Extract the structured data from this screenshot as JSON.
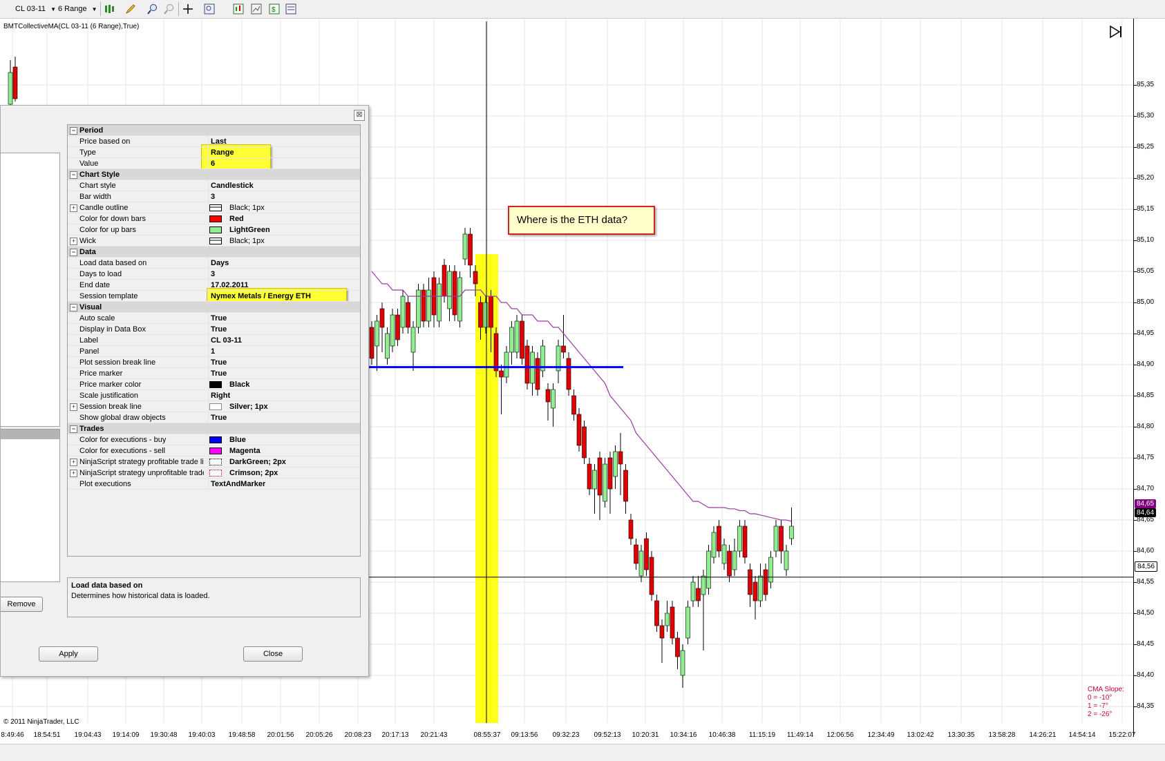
{
  "toolbar": {
    "instrument": "CL 03-11",
    "period": "6 Range"
  },
  "chart": {
    "indicator_label": "BMTCollectiveMA(CL 03-11 (6 Range),True)",
    "copyright": "© 2011 NinjaTrader, LLC",
    "callout": "Where is the ETH data?",
    "cma_slope": {
      "title": "CMA Slope:",
      "lines": [
        "0 = -10°",
        "1 = -7°",
        "2 = -26°"
      ]
    },
    "colors": {
      "up": "#90ee90",
      "down": "#e00000",
      "ma": "#9b3aa5",
      "buy_line": "#0000ff",
      "highlight": "#ffff00"
    },
    "price_badges": [
      {
        "value": "84,65",
        "color": "#800080"
      },
      {
        "value": "84,64",
        "color": "#000000"
      },
      {
        "value": "84,56",
        "color": "#ffffff"
      }
    ]
  },
  "chart_data": {
    "type": "candlestick",
    "y_axis_labels": [
      "85,35",
      "85,30",
      "85,25",
      "85,20",
      "85,15",
      "85,10",
      "85,05",
      "85,00",
      "84,95",
      "84,90",
      "84,85",
      "84,80",
      "84,75",
      "84,70",
      "84,65",
      "84,60",
      "84,55",
      "84,50",
      "84,45",
      "84,40",
      "84,35"
    ],
    "ylim": [
      84.33,
      85.38
    ],
    "x_axis_labels": [
      "8:49:46",
      "18:54:51",
      "19:04:43",
      "19:14:09",
      "19:30:48",
      "19:40:03",
      "19:48:58",
      "20:01:56",
      "20:05:26",
      "20:08:23",
      "20:17:13",
      "20:21:43",
      "08:55:37",
      "09:13:56",
      "09:32:23",
      "09:52:13",
      "10:20:31",
      "10:34:16",
      "10:46:38",
      "11:15:19",
      "11:49:14",
      "12:06:56",
      "12:34:49",
      "13:02:42",
      "13:30:35",
      "13:58:28",
      "14:26:21",
      "14:54:14",
      "15:22:07"
    ],
    "horizontal_lines": [
      84.896,
      84.558
    ],
    "candles": [
      {
        "o": 84.96,
        "c": 84.91,
        "h": 84.97,
        "l": 84.9
      },
      {
        "o": 84.93,
        "c": 84.97,
        "h": 84.98,
        "l": 84.89
      },
      {
        "o": 84.99,
        "c": 84.96,
        "h": 85.0,
        "l": 84.92
      },
      {
        "o": 84.91,
        "c": 84.95,
        "h": 84.96,
        "l": 84.9
      },
      {
        "o": 84.93,
        "c": 84.98,
        "h": 84.99,
        "l": 84.92
      },
      {
        "o": 84.98,
        "c": 84.94,
        "h": 84.99,
        "l": 84.93
      },
      {
        "o": 84.96,
        "c": 85.01,
        "h": 85.02,
        "l": 84.95
      },
      {
        "o": 85.0,
        "c": 84.96,
        "h": 85.01,
        "l": 84.95
      },
      {
        "o": 84.92,
        "c": 84.96,
        "h": 84.97,
        "l": 84.89
      },
      {
        "o": 84.96,
        "c": 85.02,
        "h": 85.03,
        "l": 84.95
      },
      {
        "o": 85.02,
        "c": 84.97,
        "h": 85.03,
        "l": 84.96
      },
      {
        "o": 84.97,
        "c": 85.02,
        "h": 85.04,
        "l": 84.96
      },
      {
        "o": 85.04,
        "c": 84.98,
        "h": 85.05,
        "l": 84.96
      },
      {
        "o": 84.97,
        "c": 85.03,
        "h": 85.04,
        "l": 84.96
      },
      {
        "o": 85.06,
        "c": 85.01,
        "h": 85.07,
        "l": 85.0
      },
      {
        "o": 84.99,
        "c": 85.05,
        "h": 85.06,
        "l": 84.97
      },
      {
        "o": 85.05,
        "c": 84.98,
        "h": 85.06,
        "l": 84.97
      },
      {
        "o": 84.97,
        "c": 85.04,
        "h": 85.05,
        "l": 84.96
      },
      {
        "o": 85.07,
        "c": 85.11,
        "h": 85.12,
        "l": 85.06
      },
      {
        "o": 85.11,
        "c": 85.06,
        "h": 85.12,
        "l": 85.04
      },
      {
        "o": 85.05,
        "c": 85.03,
        "h": 85.06,
        "l": 85.01
      },
      {
        "o": 85.0,
        "c": 84.96,
        "h": 85.01,
        "l": 84.94
      },
      {
        "o": 84.96,
        "c": 85.0,
        "h": 85.01,
        "l": 84.95
      },
      {
        "o": 85.01,
        "c": 84.96,
        "h": 85.02,
        "l": 84.92
      },
      {
        "o": 84.95,
        "c": 84.89,
        "h": 84.96,
        "l": 84.88
      },
      {
        "o": 84.89,
        "c": 84.88,
        "h": 84.9,
        "l": 84.82
      },
      {
        "o": 84.88,
        "c": 84.92,
        "h": 84.93,
        "l": 84.87
      },
      {
        "o": 84.92,
        "c": 84.96,
        "h": 84.97,
        "l": 84.9
      },
      {
        "o": 84.92,
        "c": 84.97,
        "h": 84.98,
        "l": 84.91
      },
      {
        "o": 84.97,
        "c": 84.91,
        "h": 84.98,
        "l": 84.9
      },
      {
        "o": 84.93,
        "c": 84.87,
        "h": 84.94,
        "l": 84.86
      },
      {
        "o": 84.87,
        "c": 84.92,
        "h": 84.93,
        "l": 84.85
      },
      {
        "o": 84.91,
        "c": 84.86,
        "h": 84.92,
        "l": 84.85
      },
      {
        "o": 84.89,
        "c": 84.93,
        "h": 84.94,
        "l": 84.88
      },
      {
        "o": 84.86,
        "c": 84.84,
        "h": 84.87,
        "l": 84.81
      },
      {
        "o": 84.83,
        "c": 84.86,
        "h": 84.87,
        "l": 84.8
      },
      {
        "o": 84.89,
        "c": 84.93,
        "h": 84.94,
        "l": 84.87
      },
      {
        "o": 84.93,
        "c": 84.92,
        "h": 84.98,
        "l": 84.91
      },
      {
        "o": 84.91,
        "c": 84.86,
        "h": 84.92,
        "l": 84.85
      },
      {
        "o": 84.85,
        "c": 84.82,
        "h": 84.86,
        "l": 84.81
      },
      {
        "o": 84.82,
        "c": 84.77,
        "h": 84.83,
        "l": 84.76
      },
      {
        "o": 84.8,
        "c": 84.75,
        "h": 84.81,
        "l": 84.74
      },
      {
        "o": 84.74,
        "c": 84.7,
        "h": 84.75,
        "l": 84.69
      },
      {
        "o": 84.7,
        "c": 84.73,
        "h": 84.74,
        "l": 84.66
      },
      {
        "o": 84.75,
        "c": 84.69,
        "h": 84.76,
        "l": 84.65
      },
      {
        "o": 84.68,
        "c": 84.74,
        "h": 84.75,
        "l": 84.67
      },
      {
        "o": 84.75,
        "c": 84.7,
        "h": 84.76,
        "l": 84.66
      },
      {
        "o": 84.72,
        "c": 84.76,
        "h": 84.77,
        "l": 84.7
      },
      {
        "o": 84.76,
        "c": 84.74,
        "h": 84.79,
        "l": 84.69
      },
      {
        "o": 84.73,
        "c": 84.68,
        "h": 84.74,
        "l": 84.66
      },
      {
        "o": 84.65,
        "c": 84.62,
        "h": 84.66,
        "l": 84.61
      },
      {
        "o": 84.61,
        "c": 84.58,
        "h": 84.62,
        "l": 84.57
      },
      {
        "o": 84.56,
        "c": 84.6,
        "h": 84.61,
        "l": 84.55
      },
      {
        "o": 84.62,
        "c": 84.57,
        "h": 84.63,
        "l": 84.56
      },
      {
        "o": 84.59,
        "c": 84.53,
        "h": 84.6,
        "l": 84.52
      },
      {
        "o": 84.52,
        "c": 84.48,
        "h": 84.53,
        "l": 84.47
      },
      {
        "o": 84.48,
        "c": 84.46,
        "h": 84.49,
        "l": 84.42
      },
      {
        "o": 84.48,
        "c": 84.5,
        "h": 84.52,
        "l": 84.47
      },
      {
        "o": 84.51,
        "c": 84.46,
        "h": 84.52,
        "l": 84.45
      },
      {
        "o": 84.46,
        "c": 84.43,
        "h": 84.47,
        "l": 84.41
      },
      {
        "o": 84.4,
        "c": 84.44,
        "h": 84.45,
        "l": 84.38
      },
      {
        "o": 84.46,
        "c": 84.51,
        "h": 84.52,
        "l": 84.45
      },
      {
        "o": 84.52,
        "c": 84.55,
        "h": 84.56,
        "l": 84.51
      },
      {
        "o": 84.54,
        "c": 84.52,
        "h": 84.56,
        "l": 84.51
      },
      {
        "o": 84.53,
        "c": 84.56,
        "h": 84.57,
        "l": 84.44
      },
      {
        "o": 84.54,
        "c": 84.6,
        "h": 84.61,
        "l": 84.53
      },
      {
        "o": 84.59,
        "c": 84.63,
        "h": 84.64,
        "l": 84.58
      },
      {
        "o": 84.64,
        "c": 84.6,
        "h": 84.65,
        "l": 84.59
      },
      {
        "o": 84.58,
        "c": 84.61,
        "h": 84.62,
        "l": 84.57
      },
      {
        "o": 84.6,
        "c": 84.56,
        "h": 84.61,
        "l": 84.55
      },
      {
        "o": 84.57,
        "c": 84.6,
        "h": 84.62,
        "l": 84.56
      },
      {
        "o": 84.6,
        "c": 84.64,
        "h": 84.65,
        "l": 84.59
      },
      {
        "o": 84.64,
        "c": 84.59,
        "h": 84.65,
        "l": 84.58
      },
      {
        "o": 84.57,
        "c": 84.53,
        "h": 84.58,
        "l": 84.51
      },
      {
        "o": 84.55,
        "c": 84.52,
        "h": 84.56,
        "l": 84.49
      },
      {
        "o": 84.52,
        "c": 84.56,
        "h": 84.58,
        "l": 84.51
      },
      {
        "o": 84.57,
        "c": 84.53,
        "h": 84.58,
        "l": 84.52
      },
      {
        "o": 84.55,
        "c": 84.59,
        "h": 84.6,
        "l": 84.54
      },
      {
        "o": 84.6,
        "c": 84.64,
        "h": 84.65,
        "l": 84.59
      },
      {
        "o": 84.64,
        "c": 84.6,
        "h": 84.65,
        "l": 84.58
      },
      {
        "o": 84.57,
        "c": 84.6,
        "h": 84.61,
        "l": 84.56
      },
      {
        "o": 84.62,
        "c": 84.64,
        "h": 84.67,
        "l": 84.61
      }
    ],
    "ma": [
      85.05,
      85.04,
      85.03,
      85.03,
      85.02,
      85.02,
      85.02,
      85.01,
      85.01,
      85.01,
      85.01,
      85.01,
      85.01,
      85.01,
      85.01,
      85.01,
      85.01,
      85.01,
      85.02,
      85.02,
      85.02,
      85.02,
      85.01,
      85.01,
      85.01,
      85.0,
      85.0,
      84.99,
      84.99,
      84.98,
      84.98,
      84.98,
      84.97,
      84.97,
      84.97,
      84.96,
      84.96,
      84.95,
      84.94,
      84.93,
      84.92,
      84.91,
      84.9,
      84.89,
      84.88,
      84.87,
      84.85,
      84.84,
      84.83,
      84.82,
      84.81,
      84.79,
      84.78,
      84.77,
      84.76,
      84.75,
      84.74,
      84.73,
      84.72,
      84.71,
      84.7,
      84.69,
      84.68,
      84.68,
      84.675,
      84.67,
      84.67,
      84.67,
      84.67,
      84.668,
      84.668,
      84.665,
      84.665,
      84.66,
      84.66,
      84.658,
      84.656,
      84.654,
      84.652,
      84.65,
      84.65,
      84.648
    ]
  },
  "dialog": {
    "close_glyph": "⊠",
    "rows": [
      {
        "type": "cat",
        "name": "Period"
      },
      {
        "name": "Price based on",
        "value": "Last"
      },
      {
        "name": "Type",
        "value": "Range"
      },
      {
        "name": "Value",
        "value": "6"
      },
      {
        "type": "cat",
        "name": "Chart Style"
      },
      {
        "name": "Chart style",
        "value": "Candlestick"
      },
      {
        "name": "Bar width",
        "value": "3"
      },
      {
        "name": "Candle outline",
        "value": "Black; 1px",
        "swatch": "outline",
        "expand": true,
        "plain": true
      },
      {
        "name": "Color for down bars",
        "value": "Red",
        "swatch": "#ff0000"
      },
      {
        "name": "Color for up bars",
        "value": "LightGreen",
        "swatch": "#90ee90"
      },
      {
        "name": "Wick",
        "value": "Black; 1px",
        "swatch": "outline",
        "expand": true,
        "plain": true
      },
      {
        "type": "cat",
        "name": "Data"
      },
      {
        "name": "Load data based on",
        "value": "Days"
      },
      {
        "name": "Days to load",
        "value": "3"
      },
      {
        "name": "End date",
        "value": "17.02.2011"
      },
      {
        "name": "Session template",
        "value": "Nymex Metals / Energy ETH"
      },
      {
        "type": "cat",
        "name": "Visual"
      },
      {
        "name": "Auto scale",
        "value": "True"
      },
      {
        "name": "Display in Data Box",
        "value": "True"
      },
      {
        "name": "Label",
        "value": "CL 03-11"
      },
      {
        "name": "Panel",
        "value": "1"
      },
      {
        "name": "Plot session break line",
        "value": "True"
      },
      {
        "name": "Price marker",
        "value": "True"
      },
      {
        "name": "Price marker color",
        "value": "Black",
        "swatch": "#000000"
      },
      {
        "name": "Scale justification",
        "value": "Right"
      },
      {
        "name": "Session break line",
        "value": "Silver; 1px",
        "swatch": "silver",
        "expand": true
      },
      {
        "name": "Show global draw objects",
        "value": "True"
      },
      {
        "type": "cat",
        "name": "Trades"
      },
      {
        "name": "Color for executions - buy",
        "value": "Blue",
        "swatch": "#0000ff"
      },
      {
        "name": "Color for executions - sell",
        "value": "Magenta",
        "swatch": "#ff00ff"
      },
      {
        "name": "NinjaScript strategy profitable trade li",
        "value": "DarkGreen; 2px",
        "swatch": "dotted-green",
        "expand": true
      },
      {
        "name": "NinjaScript strategy unprofitable trade",
        "value": "Crimson; 2px",
        "swatch": "dotted-red",
        "expand": true
      },
      {
        "name": "Plot executions",
        "value": "TextAndMarker"
      }
    ],
    "description": {
      "title": "Load data based on",
      "text": "Determines how historical data is loaded."
    },
    "buttons": {
      "remove": "Remove",
      "apply": "Apply",
      "close": "Close"
    }
  }
}
